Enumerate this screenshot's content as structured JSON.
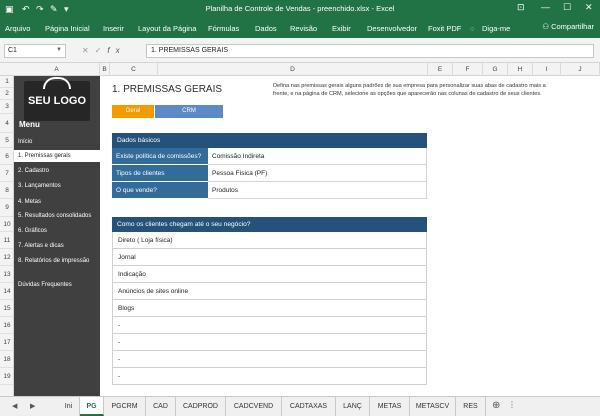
{
  "window": {
    "title": "Planilha de Controle de Vendas - preenchido.xlsx - Excel"
  },
  "ribbon": {
    "tabs": [
      "Arquivo",
      "Página Inicial",
      "Inserir",
      "Layout da Página",
      "Fórmulas",
      "Dados",
      "Revisão",
      "Exibir",
      "Desenvolvedor",
      "Foxit PDF"
    ],
    "tell_me": "Diga-me",
    "share": "Compartilhar"
  },
  "formula_bar": {
    "name_box": "C1",
    "fx": "fx",
    "value": "1. PREMISSAS GERAIS"
  },
  "columns": [
    "A",
    "B",
    "C",
    "D",
    "E",
    "F",
    "G",
    "H",
    "I",
    "J"
  ],
  "rows": [
    "1",
    "2",
    "3",
    "4",
    "5",
    "6",
    "7",
    "8",
    "9",
    "10",
    "11",
    "12",
    "13",
    "14",
    "15",
    "16",
    "17",
    "18",
    "19"
  ],
  "sidebar": {
    "logo": "SEU LOGO",
    "menu_label": "Menu",
    "items": [
      "Início",
      "1. Premissas gerais",
      "2. Cadastro",
      "3. Lançamentos",
      "4. Metas",
      "5. Resultados consolidados",
      "6. Gráficos",
      "7. Alertas e dicas",
      "8. Relatórios de impressão",
      "Dúvidas Frequentes"
    ],
    "active_index": 1
  },
  "main": {
    "title": "1. PREMISSAS GERAIS",
    "description": "Defina nas premissas gerais alguns padrões de sua empresa para personalizar suas abas de cadastro mais a frente, e na página de CRM, selecione as opções que aparecerão nas colunas de cadastro de seus clientes.",
    "tabs": [
      "Geral",
      "CRM"
    ],
    "basic": {
      "header": "Dados básicos",
      "rows": [
        {
          "key": "Existe política de comissões?",
          "value": "Comissão Indireta"
        },
        {
          "key": "Tipos de clientes",
          "value": "Pessoa Física (PF)"
        },
        {
          "key": "O que vende?",
          "value": "Produtos"
        }
      ]
    },
    "channels": {
      "header": "Como os clientes chegam até o seu negócio?",
      "items": [
        "Direto ( Loja física)",
        "Jornal",
        "Indicação",
        "Anúncios de sites online",
        "Blogs",
        "-",
        "-",
        "-",
        "-"
      ]
    }
  },
  "sheet_tabs": {
    "tabs": [
      "Ini",
      "PG",
      "PGCRM",
      "CAD",
      "CADPROD",
      "CADCVEND",
      "CADTAXAS",
      "LANÇ",
      "METAS",
      "METASCV",
      "RES"
    ],
    "active": "PG"
  },
  "colors": {
    "excel_green": "#217346",
    "navy_header": "#24527a",
    "key_blue": "#336b9a",
    "tab_orange": "#f29a00",
    "tab_blue": "#5b8ac6",
    "sidebar_gray": "#404040"
  }
}
